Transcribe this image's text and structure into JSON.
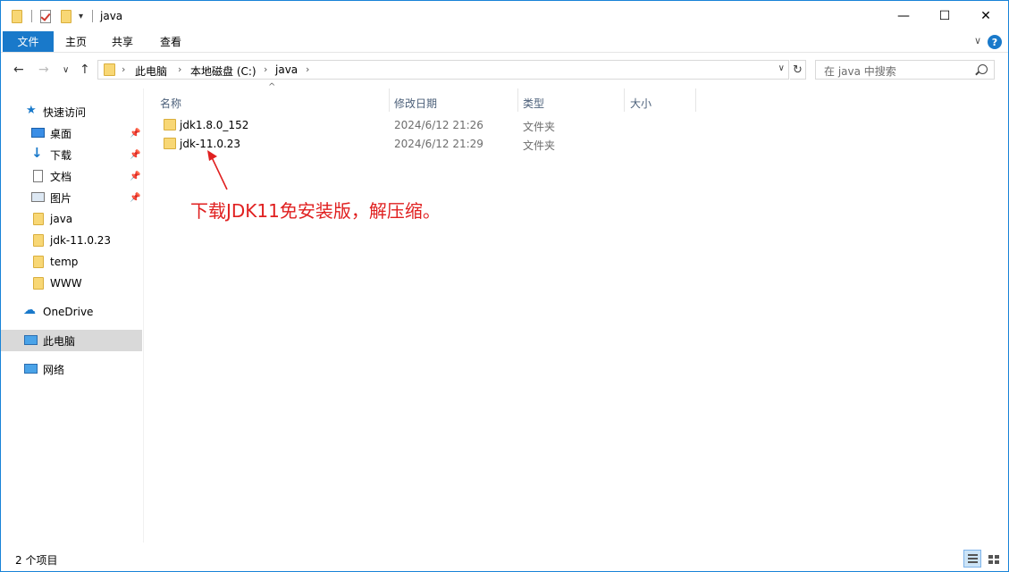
{
  "window": {
    "title": "java",
    "minimize": "—",
    "maximize": "☐",
    "close": "✕"
  },
  "ribbon": {
    "tabs": [
      "文件",
      "主页",
      "共享",
      "查看"
    ],
    "expand": "∨",
    "help": "?"
  },
  "nav": {
    "back": "←",
    "forward": "→",
    "recent": "∨",
    "up": "↑",
    "breadcrumb": [
      "此电脑",
      "本地磁盘 (C:)",
      "java"
    ],
    "refresh": "↻",
    "search_placeholder": "在 java 中搜索"
  },
  "sidebar": {
    "quick_access": "快速访问",
    "items": [
      {
        "label": "桌面",
        "icon": "desktop-icon",
        "pinned": true
      },
      {
        "label": "下载",
        "icon": "download-icon",
        "pinned": true
      },
      {
        "label": "文档",
        "icon": "document-icon",
        "pinned": true
      },
      {
        "label": "图片",
        "icon": "pictures-icon",
        "pinned": true
      },
      {
        "label": "java",
        "icon": "folder-icon",
        "pinned": false
      },
      {
        "label": "jdk-11.0.23",
        "icon": "folder-icon",
        "pinned": false
      },
      {
        "label": "temp",
        "icon": "folder-icon",
        "pinned": false
      },
      {
        "label": "WWW",
        "icon": "folder-icon",
        "pinned": false
      }
    ],
    "onedrive": "OneDrive",
    "this_pc": "此电脑",
    "network": "网络"
  },
  "columns": {
    "name": "名称",
    "date": "修改日期",
    "type": "类型",
    "size": "大小"
  },
  "files": [
    {
      "name": "jdk1.8.0_152",
      "date": "2024/6/12 21:26",
      "type": "文件夹"
    },
    {
      "name": "jdk-11.0.23",
      "date": "2024/6/12 21:29",
      "type": "文件夹"
    }
  ],
  "annotation": "下载JDK11免安装版，解压缩。",
  "status": {
    "count": "2 个项目"
  },
  "colors": {
    "accent": "#1979ca",
    "annotation": "#e02020",
    "selected": "#d9d9d9"
  }
}
